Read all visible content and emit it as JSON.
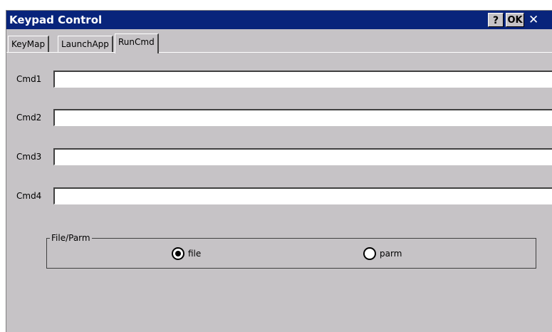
{
  "window": {
    "title": "Keypad Control",
    "help_label": "?",
    "ok_label": "OK",
    "close_label": "✕"
  },
  "tabs": [
    {
      "label": "KeyMap",
      "active": false
    },
    {
      "label": "LaunchApp",
      "active": false
    },
    {
      "label": "RunCmd",
      "active": true
    }
  ],
  "fields": [
    {
      "label": "Cmd1",
      "value": ""
    },
    {
      "label": "Cmd2",
      "value": ""
    },
    {
      "label": "Cmd3",
      "value": ""
    },
    {
      "label": "Cmd4",
      "value": ""
    }
  ],
  "file_parm": {
    "title": "File/Parm",
    "options": [
      {
        "label": "file",
        "selected": true
      },
      {
        "label": "parm",
        "selected": false
      }
    ]
  },
  "colors": {
    "titlebar": "#08247b",
    "dialog_bg": "#c6c3c6"
  }
}
